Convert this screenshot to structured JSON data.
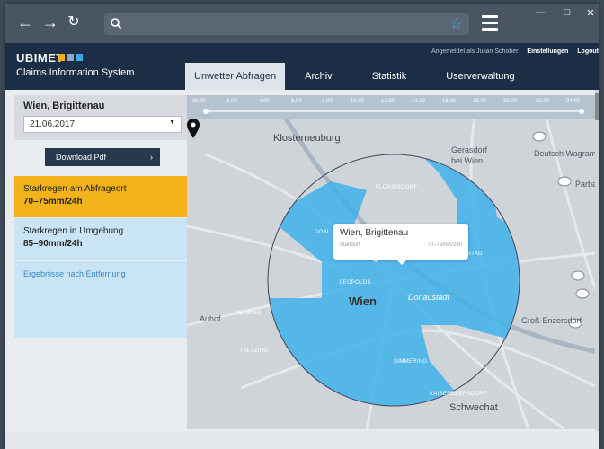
{
  "browser": {
    "back_icon": "arrow-left-icon",
    "forward_icon": "arrow-right-icon",
    "reload_icon": "reload-icon",
    "url_value": "",
    "controls": [
      "minimize-icon",
      "maximize-icon",
      "close-icon"
    ]
  },
  "app": {
    "logo": "UBIMET",
    "logo_colors": [
      "#f2b21a",
      "#8fa9c4",
      "#3aa9f0"
    ],
    "subtitle": "Claims Information System",
    "user_text": "Angemeldet als Julian Schober",
    "settings_link": "Einstellungen",
    "logout_link": "Logout",
    "tabs": [
      {
        "label": "Unwetter Abfragen",
        "active": true
      },
      {
        "label": "Archiv",
        "active": false
      },
      {
        "label": "Statistik",
        "active": false
      },
      {
        "label": "Userverwaltung",
        "active": false
      }
    ]
  },
  "sidebar": {
    "location": "Wien, Brigittenau",
    "date": "21.06.2017",
    "pdf_button": "Download Pdf",
    "cards": [
      {
        "title": "Starkregen am Abfrageort",
        "value": "70–75mm/24h",
        "color": "#f2b21a"
      },
      {
        "title": "Starkregen in Umgebung",
        "value": "85–90mm/24h",
        "color": "#c9e5f5"
      }
    ],
    "link": "Ergebnisse nach Entfernung"
  },
  "map": {
    "timeline": [
      "00.00",
      "2.00",
      "4.00",
      "6.00",
      "8.00",
      "10.00",
      "12.00",
      "14.00",
      "16.00",
      "18.00",
      "20.00",
      "22.00",
      "24.00"
    ],
    "labels": {
      "klosterneuburg": "Klosterneuburg",
      "gerasdorf": "Gerasdorf",
      "bei_wien": "bei Wien",
      "deutsch_wagram": "Deutsch Wagram",
      "parbasdorf": "Parba",
      "floridsdorf": "FLORIDSDORF",
      "wien": "Wien",
      "donaustadt": "Donaustadt",
      "auhof": "Auhof",
      "penzing": "PENZING",
      "leopoldstadt": "LEOPOLDS",
      "hietzing": "HIETZING",
      "simmering": "SIMMERING",
      "grossenzersdorf": "Groß-Enzersdorf",
      "schwechat": "Schwechat",
      "kaiserebersdorf": "KAISEREBERSDORF",
      "dobling": "DOBL",
      "stadt": "STADT"
    },
    "road_badges": [
      "A22",
      "S2",
      "S1",
      "A4"
    ],
    "popup": {
      "title": "Wien, Brigittenau",
      "label": "Standort",
      "value": "70–75mm/24h"
    },
    "rain_color": "#3fb0ea"
  }
}
